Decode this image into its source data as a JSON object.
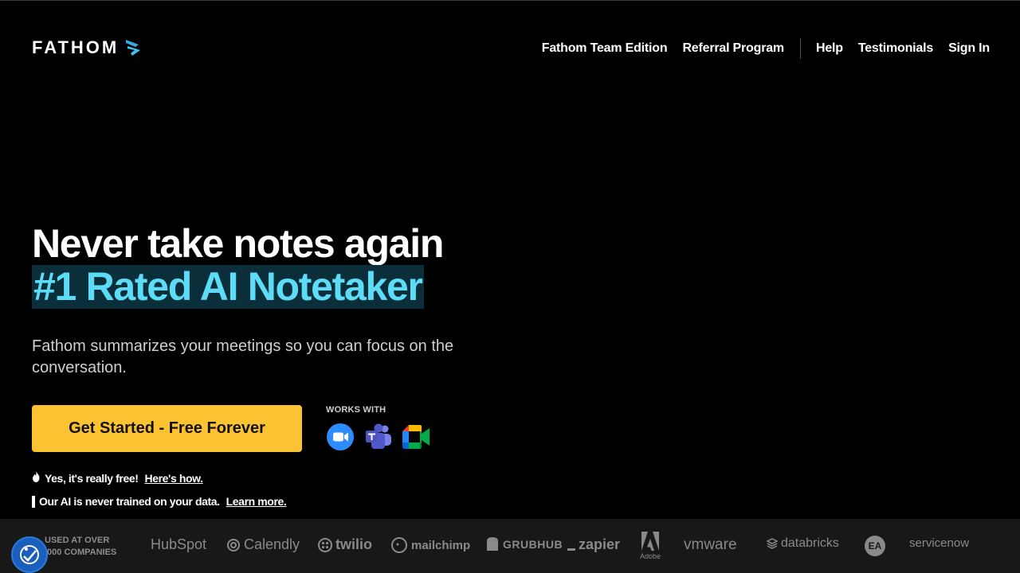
{
  "header": {
    "logo_text": "FATHOM",
    "nav": [
      "Fathom Team Edition",
      "Referral Program",
      "Help",
      "Testimonials",
      "Sign In"
    ]
  },
  "hero": {
    "headline": "Never take notes again",
    "headline_accent": "#1 Rated AI Notetaker",
    "subtitle": "Fathom summarizes your meetings so you can focus on the conversation.",
    "cta_label": "Get Started - Free Forever",
    "works_with_label": "WORKS WITH",
    "works_with_icons": [
      "zoom-icon",
      "teams-icon",
      "google-meet-icon"
    ],
    "note1_text": "Yes, it's really free!",
    "note1_link": "Here's how.",
    "note2_text": "Our AI is never trained on your data.",
    "note2_link": "Learn more."
  },
  "logos_strip": {
    "used_line1": "USED AT OVER",
    "used_line2": ",000 COMPANIES",
    "brands": [
      "HubSpot",
      "Calendly",
      "twilio",
      "mailchimp",
      "GRUBHUB",
      "zapier",
      "Adobe",
      "vmware",
      "databricks",
      "EA",
      "servicenow"
    ]
  },
  "colors": {
    "background": "#000000",
    "accent_cyan": "#5ddcf7",
    "accent_highlight_bg": "#0b2f3a",
    "cta_yellow": "#fbc231",
    "strip_bg": "#181818"
  }
}
